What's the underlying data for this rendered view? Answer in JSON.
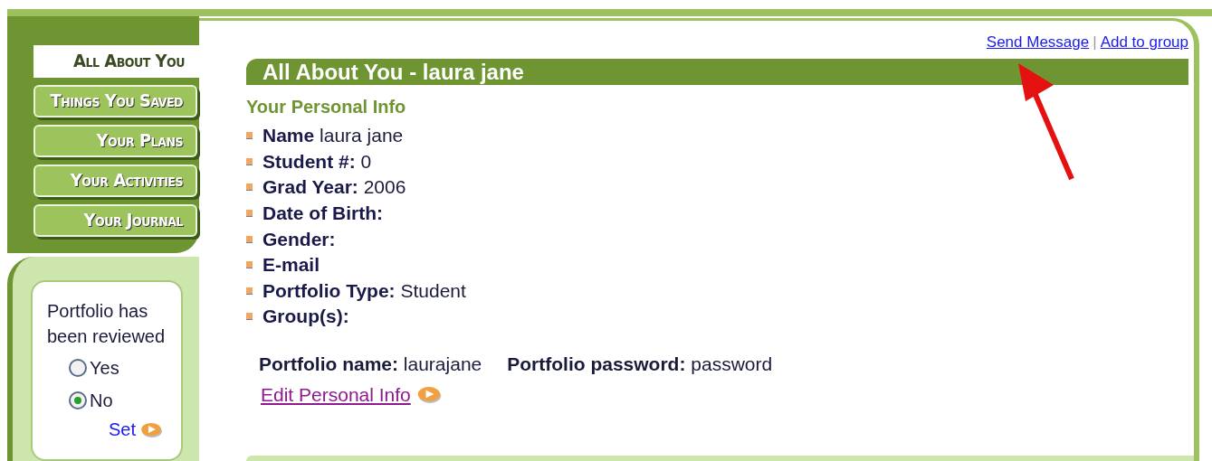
{
  "nav": [
    {
      "label": "All About You",
      "selected": true
    },
    {
      "label": "Things You Saved",
      "selected": false
    },
    {
      "label": "Your Plans",
      "selected": false
    },
    {
      "label": "Your Activities",
      "selected": false
    },
    {
      "label": "Your Journal",
      "selected": false
    }
  ],
  "review": {
    "label": "Portfolio has been reviewed",
    "options": [
      {
        "label": "Yes",
        "selected": false
      },
      {
        "label": "No",
        "selected": true
      }
    ],
    "action": "Set"
  },
  "links": [
    "Send Message",
    "Add to group"
  ],
  "link_separator": "|",
  "title": "All About You - laura jane",
  "section_title": "Your Personal Info",
  "fields": [
    {
      "label": "Name",
      "value": "laura jane"
    },
    {
      "label": "Student #:",
      "value": "0"
    },
    {
      "label": "Grad Year:",
      "value": "2006"
    },
    {
      "label": "Date of Birth:"
    },
    {
      "label": "Gender:"
    },
    {
      "label": "E-mail"
    },
    {
      "label": "Portfolio Type:",
      "value": "Student"
    },
    {
      "label": "Group(s):"
    }
  ],
  "credentials": [
    {
      "label": "Portfolio name:",
      "value": "laurajane"
    },
    {
      "label": "Portfolio password:",
      "value": "password"
    }
  ],
  "edit_link": "Edit Personal Info"
}
